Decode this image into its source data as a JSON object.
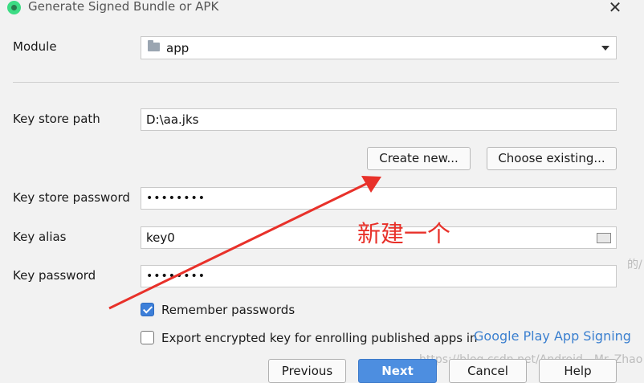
{
  "window": {
    "title": "Generate Signed Bundle or APK",
    "close_glyph": "✕",
    "icon": "android-studio-icon"
  },
  "module": {
    "label": "Module",
    "value": "app"
  },
  "keystore": {
    "path_label": "Key store path",
    "path_value": "D:\\aa.jks",
    "create_new_label": "Create new...",
    "choose_existing_label": "Choose existing...",
    "password_label": "Key store password",
    "password_value": "••••••••"
  },
  "key": {
    "alias_label": "Key alias",
    "alias_value": "key0",
    "password_label": "Key password",
    "password_value": "••••••••"
  },
  "options": {
    "remember_label": "Remember passwords",
    "remember_checked": true,
    "export_label": "Export encrypted key for enrolling published apps in",
    "export_checked": false,
    "link_text": "Google Play App Signing"
  },
  "annotation": {
    "text": "新建一个",
    "color": "#e8312a"
  },
  "watermark": "https://blog.csdn.net/Android__Mr_Zhao",
  "side_fragment": "的/",
  "footer": {
    "previous": "Previous",
    "next": "Next",
    "cancel": "Cancel",
    "help": "Help"
  },
  "colors": {
    "accent": "#3d7fd9",
    "link": "#3a7fcf",
    "primary_button": "#4d8ee0"
  }
}
